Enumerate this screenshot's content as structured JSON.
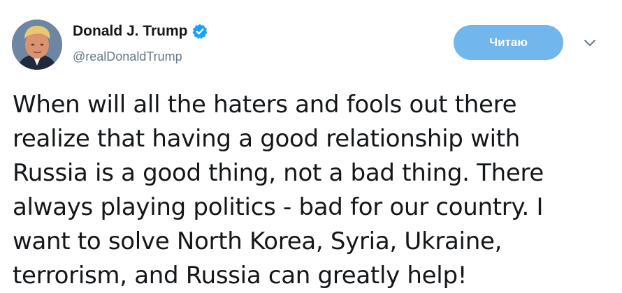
{
  "author": {
    "display_name": "Donald J. Trump",
    "handle": "@realDonaldTrump",
    "verified": true,
    "avatar_icon": "profile-photo"
  },
  "actions": {
    "follow_label": "Читаю",
    "menu_icon": "chevron-down-icon"
  },
  "tweet": {
    "text": "When will all the haters and fools out there\nrealize that having a good relationship with\nRussia is a good thing, not a bad thing. There\nalways playing politics - bad for our country. I\nwant to solve North Korea, Syria, Ukraine,\nterrorism, and Russia can greatly help!"
  },
  "colors": {
    "button_bg": "#71b6ec",
    "verified_badge": "#1da1f2",
    "handle_text": "#657786",
    "body_text": "#14171a"
  }
}
